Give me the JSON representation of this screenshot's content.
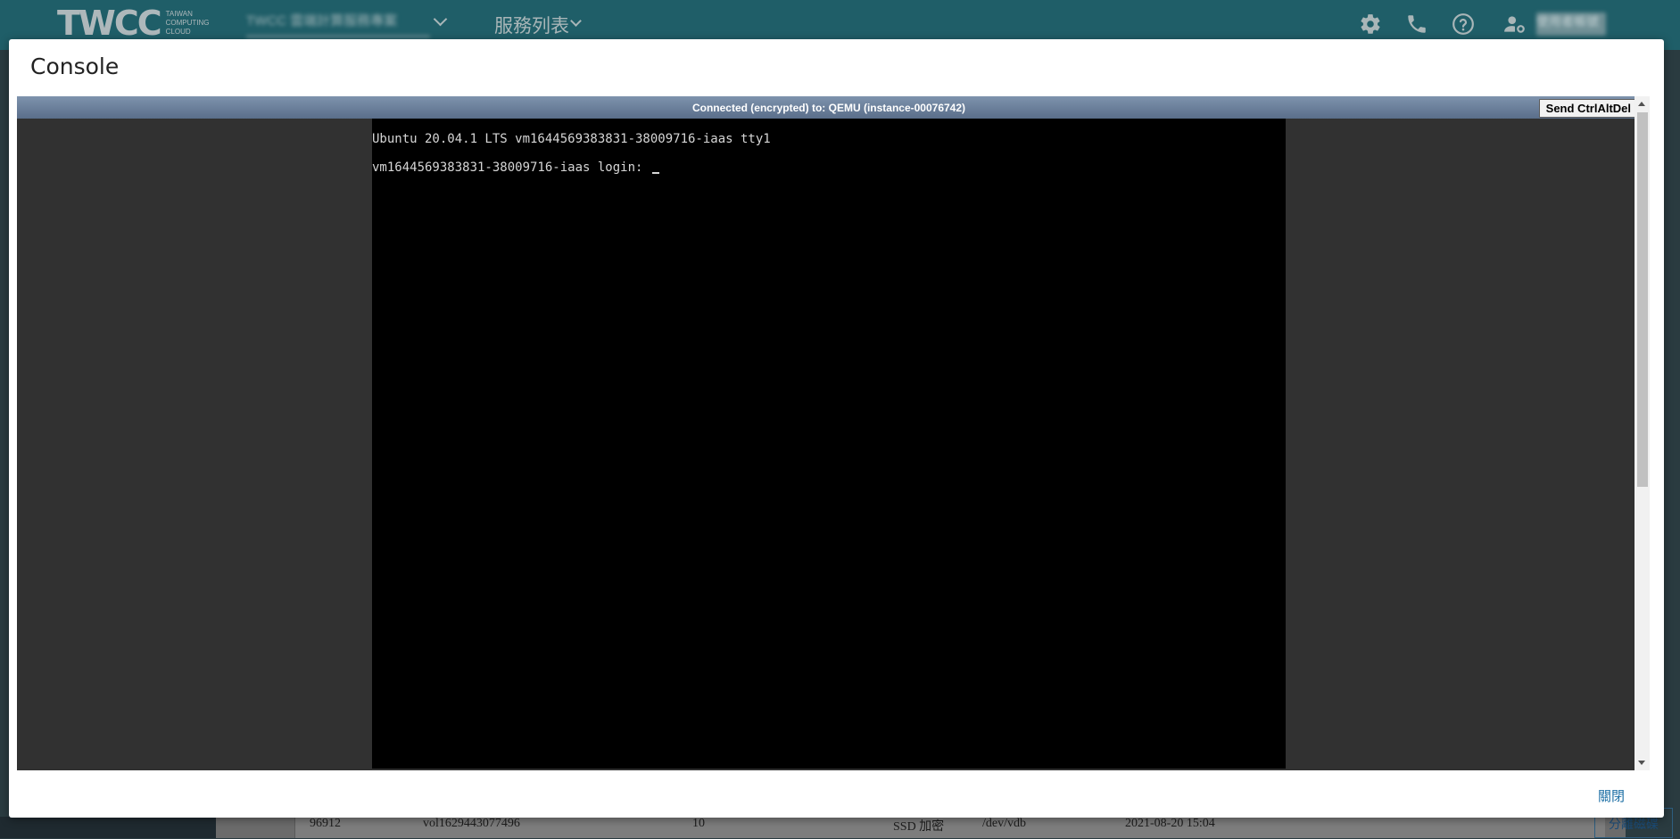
{
  "background": {
    "logo": {
      "text": "TWCC",
      "subtitle_lines": [
        "TAIWAN",
        "COMPUTING",
        "CLOUD"
      ]
    },
    "project_selector": {
      "value": "TWCC 雲端計算服務專案"
    },
    "services_menu": {
      "label": "服務列表"
    },
    "header_icons": [
      "gear-icon",
      "phone-icon",
      "help-icon",
      "user-settings-icon"
    ],
    "user_name": "使用者帳號",
    "table_row": {
      "id": "96912",
      "name": "vol1629443077496",
      "size": "10",
      "type": "SSD 加密",
      "device": "/dev/vdb",
      "created": "2021-08-20 15:04",
      "action": "分離磁碟"
    }
  },
  "modal": {
    "title": "Console",
    "status_bar": "Connected (encrypted) to: QEMU (instance-00076742)",
    "send_cad_button": "Send CtrlAltDel",
    "terminal_lines": [
      "Ubuntu 20.04.1 LTS vm1644569383831-38009716-iaas tty1",
      "vm1644569383831-38009716-iaas login: "
    ],
    "close_button": "關閉"
  },
  "colors": {
    "topbar": "#1f5e68",
    "status_bar": "#6c819c",
    "console_bg": "#313131",
    "terminal_bg": "#000000",
    "link": "#1d6fa5"
  }
}
